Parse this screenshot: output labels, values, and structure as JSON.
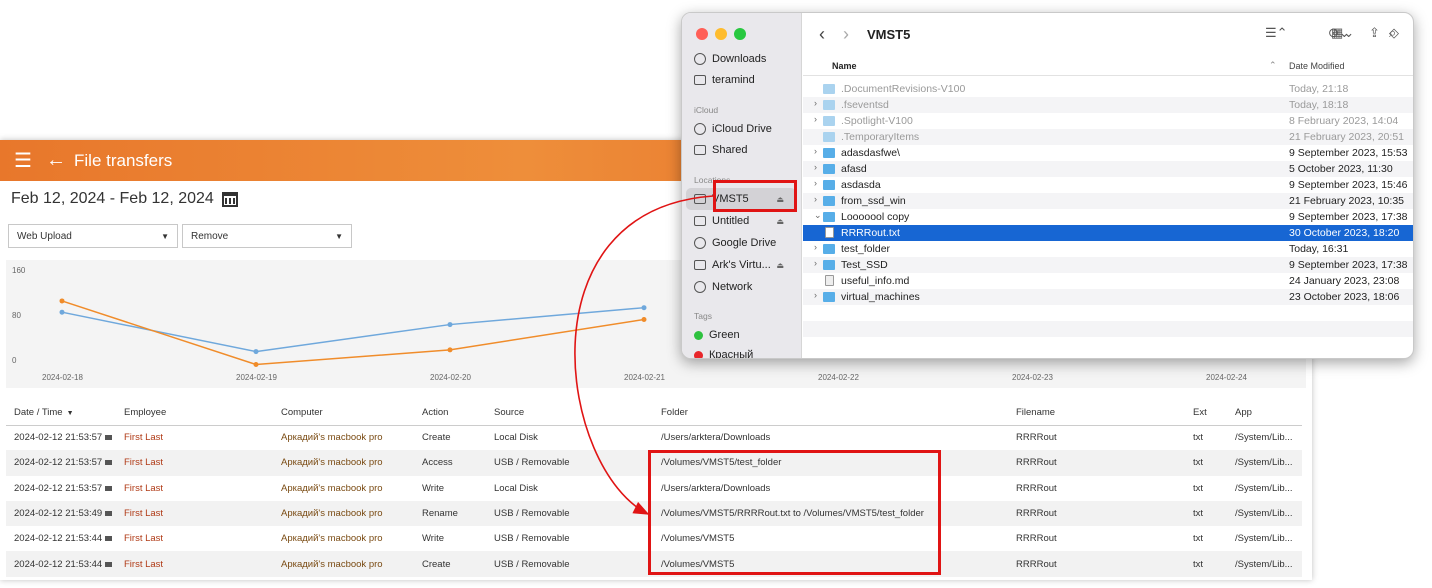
{
  "app": {
    "title": "File transfers",
    "date_range": "Feb 12, 2024 - Feb 12, 2024",
    "filters": [
      {
        "value": "Web Upload"
      },
      {
        "value": "Remove"
      }
    ]
  },
  "chart_data": {
    "type": "line",
    "x": [
      "2024-02-18",
      "2024-02-19",
      "2024-02-20",
      "2024-02-21",
      "2024-02-22",
      "2024-02-23",
      "2024-02-24"
    ],
    "y_ticks": [
      "160",
      "80",
      "0"
    ],
    "ylim": [
      0,
      160
    ],
    "series": [
      {
        "color": "#6fa8dc",
        "values": [
          85,
          15,
          63,
          93,
          null,
          null,
          null
        ]
      },
      {
        "color": "#f08c2a",
        "values": [
          105,
          -8,
          18,
          72,
          null,
          null,
          null
        ]
      }
    ]
  },
  "table": {
    "columns": [
      "Date / Time",
      "Employee",
      "Computer",
      "Action",
      "Source",
      "Folder",
      "Filename",
      "Ext",
      "App"
    ],
    "sort_indicator": "▼",
    "rows": [
      [
        "2024-02-12 21:53:57",
        "First Last",
        "Аркадий's macbook pro",
        "Create",
        "Local Disk",
        "/Users/arktera/Downloads",
        "RRRRout",
        "txt",
        "/System/Lib..."
      ],
      [
        "2024-02-12 21:53:57",
        "First Last",
        "Аркадий's macbook pro",
        "Access",
        "USB / Removable",
        "/Volumes/VMST5/test_folder",
        "RRRRout",
        "txt",
        "/System/Lib..."
      ],
      [
        "2024-02-12 21:53:57",
        "First Last",
        "Аркадий's macbook pro",
        "Write",
        "Local Disk",
        "/Users/arktera/Downloads",
        "RRRRout",
        "txt",
        "/System/Lib..."
      ],
      [
        "2024-02-12 21:53:49",
        "First Last",
        "Аркадий's macbook pro",
        "Rename",
        "USB / Removable",
        "/Volumes/VMST5/RRRRout.txt to /Volumes/VMST5/test_folder",
        "RRRRout",
        "txt",
        "/System/Lib..."
      ],
      [
        "2024-02-12 21:53:44",
        "First Last",
        "Аркадий's macbook pro",
        "Write",
        "USB / Removable",
        "/Volumes/VMST5",
        "RRRRout",
        "txt",
        "/System/Lib..."
      ],
      [
        "2024-02-12 21:53:44",
        "First Last",
        "Аркадий's macbook pro",
        "Create",
        "USB / Removable",
        "/Volumes/VMST5",
        "RRRRout",
        "txt",
        "/System/Lib..."
      ]
    ]
  },
  "finder": {
    "title": "VMST5",
    "sidebar": {
      "items_top": [
        "Downloads",
        "teramind"
      ],
      "icloud_label": "iCloud",
      "icloud_items": [
        "iCloud Drive",
        "Shared"
      ],
      "locations_label": "Locations",
      "locations": [
        "VMST5",
        "Untitled",
        "Google Drive",
        "Ark's Virtu...",
        "Network"
      ],
      "tags_label": "Tags",
      "tags": [
        {
          "name": "Green",
          "color": "#2ec13f"
        },
        {
          "name": "Красный",
          "color": "#e8262b"
        }
      ]
    },
    "columns": {
      "name": "Name",
      "date": "Date Modified"
    },
    "files": [
      {
        "name": ".DocumentRevisions-V100",
        "date": "Today, 21:18"
      },
      {
        "name": ".fseventsd",
        "date": "Today, 18:18"
      },
      {
        "name": ".Spotlight-V100",
        "date": "8 February 2023, 14:04"
      },
      {
        "name": ".TemporaryItems",
        "date": "21 February 2023, 20:51"
      },
      {
        "name": "adasdasfwe\\",
        "date": "9 September 2023, 15:53"
      },
      {
        "name": "afasd",
        "date": "5 October 2023, 11:30"
      },
      {
        "name": "asdasda",
        "date": "9 September 2023, 15:46"
      },
      {
        "name": "from_ssd_win",
        "date": "21 February 2023, 10:35"
      },
      {
        "name": "Looooool copy",
        "date": "9 September 2023, 17:38"
      },
      {
        "name": "RRRRout.txt",
        "date": "30 October 2023, 18:20"
      },
      {
        "name": "test_folder",
        "date": "Today, 16:31"
      },
      {
        "name": "Test_SSD",
        "date": "9 September 2023, 17:38"
      },
      {
        "name": "useful_info.md",
        "date": "24 January 2023, 23:08"
      },
      {
        "name": "virtual_machines",
        "date": "23 October 2023, 18:06"
      }
    ]
  }
}
